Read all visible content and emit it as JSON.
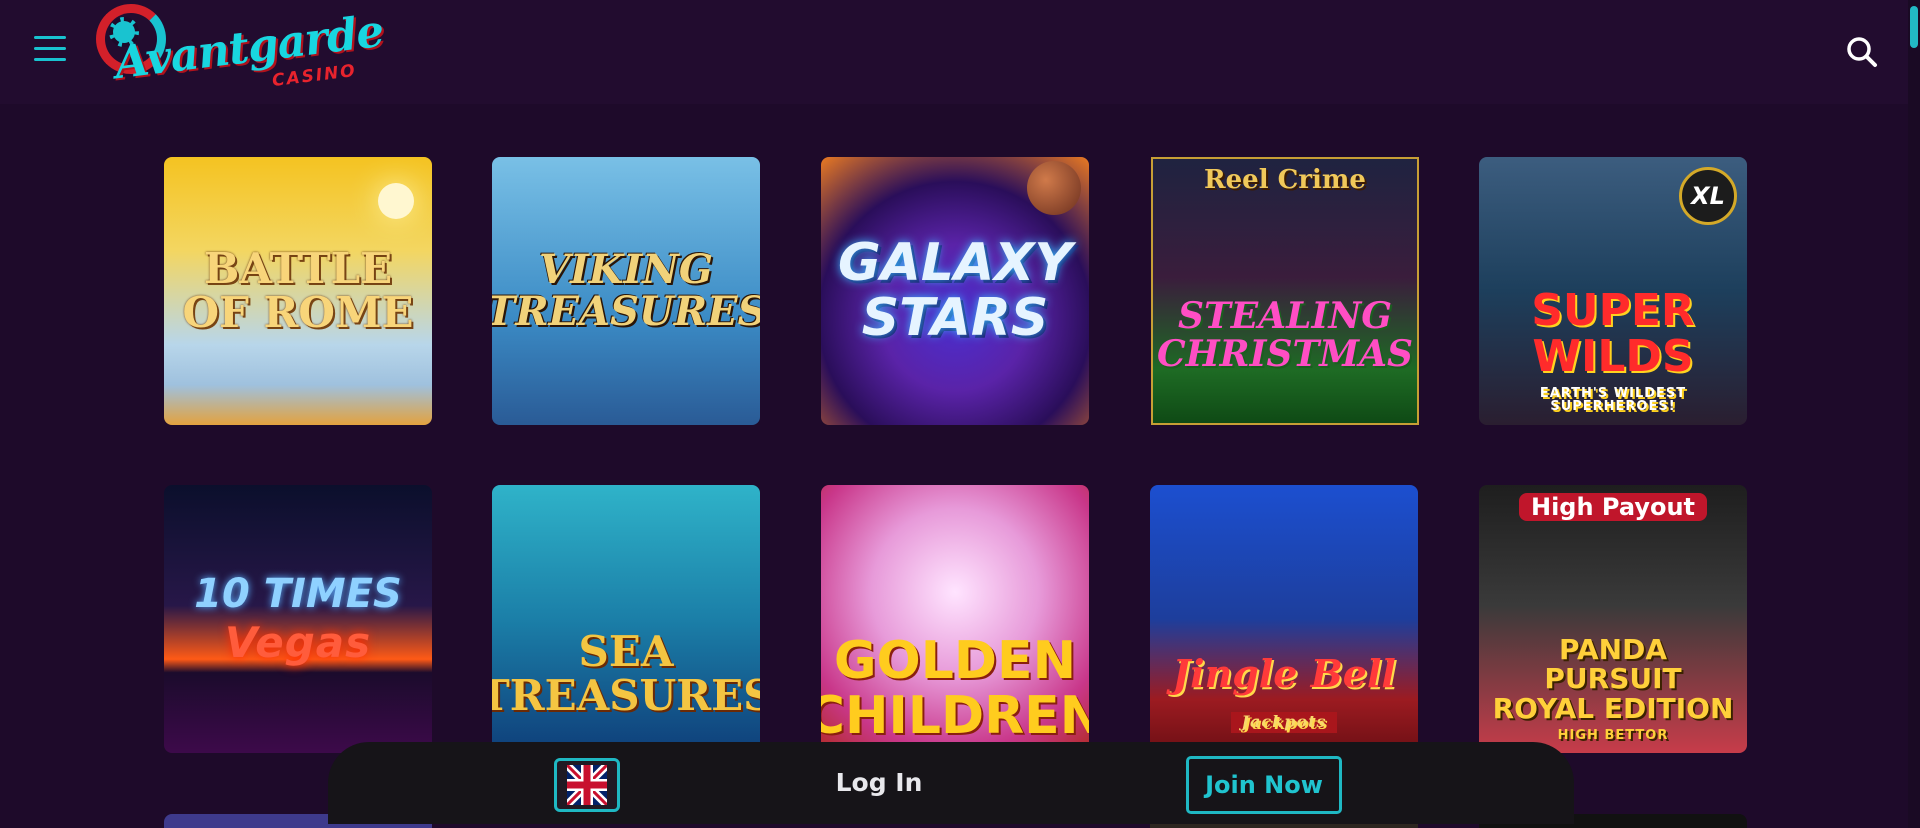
{
  "header": {
    "logo_text": "Avantgarde",
    "logo_subtext": "CASINO",
    "menu_icon": "hamburger-menu-icon",
    "search_icon": "search-icon"
  },
  "games": [
    {
      "title": "Battle of Rome"
    },
    {
      "title": "Viking Treasures"
    },
    {
      "title": "Galaxy Stars"
    },
    {
      "top": "Reel Crime",
      "title": "Stealing Christmas"
    },
    {
      "title": "Super Wilds",
      "sub": "Earth's Wildest Superheroes!",
      "badge": "XL"
    },
    {
      "title": "10 Times",
      "sub": "Vegas"
    },
    {
      "title": "Sea Treasures"
    },
    {
      "title": "Golden Children"
    },
    {
      "title": "Jingle Bell",
      "sub": "Jackpots"
    },
    {
      "top": "High Payout",
      "title": "Panda Pursuit Royal Edition",
      "sub": "High Bettor"
    }
  ],
  "bottom_bar": {
    "language_icon": "uk-flag-icon",
    "login_label": "Log In",
    "join_label": "Join Now"
  },
  "colors": {
    "background": "#1e0a2a",
    "accent": "#1fb8c3",
    "brand_red": "#e8232d"
  }
}
